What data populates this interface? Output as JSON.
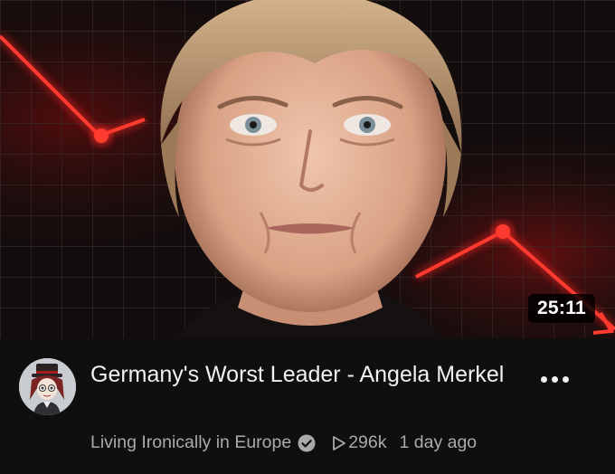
{
  "video": {
    "duration": "25:11",
    "title": "Germany's Worst Leader - Angela Merkel",
    "channel": "Living Ironically in Europe",
    "views": "296k",
    "age": "1 day ago"
  },
  "icons": {
    "verified": "verified-check-icon",
    "views": "play-outline-icon",
    "menu": "more-vert-icon"
  },
  "colors": {
    "background": "#0f0f0f",
    "text_primary": "#f1f1f1",
    "text_secondary": "#aaaaaa",
    "accent_red": "#e3141c"
  }
}
